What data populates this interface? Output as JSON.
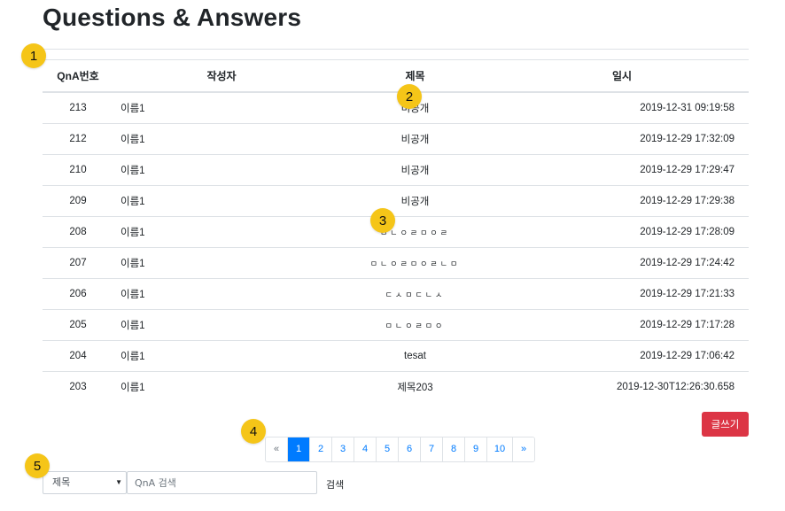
{
  "page_title": "Questions & Answers",
  "table": {
    "headers": {
      "no": "QnA번호",
      "writer": "작성자",
      "title": "제목",
      "date": "일시"
    },
    "rows": [
      {
        "no": "213",
        "writer": "이름1",
        "title": "비공개",
        "date": "2019-12-31 09:19:58",
        "kind": "private"
      },
      {
        "no": "212",
        "writer": "이름1",
        "title": "비공개",
        "date": "2019-12-29 17:32:09",
        "kind": "private"
      },
      {
        "no": "210",
        "writer": "이름1",
        "title": "비공개",
        "date": "2019-12-29 17:29:47",
        "kind": "private"
      },
      {
        "no": "209",
        "writer": "이름1",
        "title": "비공개",
        "date": "2019-12-29 17:29:38",
        "kind": "private"
      },
      {
        "no": "208",
        "writer": "이름1",
        "title": "ㅁㄴㅇㄹㅁㅇㄹ",
        "date": "2019-12-29 17:28:09",
        "kind": "jamo"
      },
      {
        "no": "207",
        "writer": "이름1",
        "title": "ㅁㄴㅇㄹㅁㅇㄹㄴㅁ",
        "date": "2019-12-29 17:24:42",
        "kind": "jamo"
      },
      {
        "no": "206",
        "writer": "이름1",
        "title": "ㄷㅅㅁㄷㄴㅅ",
        "date": "2019-12-29 17:21:33",
        "kind": "jamo"
      },
      {
        "no": "205",
        "writer": "이름1",
        "title": "ㅁㄴㅇㄹㅁㅇ",
        "date": "2019-12-29 17:17:28",
        "kind": "jamo"
      },
      {
        "no": "204",
        "writer": "이름1",
        "title": "tesat",
        "date": "2019-12-29 17:06:42",
        "kind": "link"
      },
      {
        "no": "203",
        "writer": "이름1",
        "title": "제목203",
        "date": "2019-12-30T12:26:30.658",
        "kind": "link"
      }
    ]
  },
  "write_button": "글쓰기",
  "pagination": {
    "prev": "«",
    "pages": [
      "1",
      "2",
      "3",
      "4",
      "5",
      "6",
      "7",
      "8",
      "9",
      "10"
    ],
    "next": "»",
    "active": "1"
  },
  "search": {
    "select_value": "제목",
    "input_placeholder": "QnA 검색",
    "button_label": "검색"
  },
  "annotations": [
    "1",
    "2",
    "3",
    "4",
    "5"
  ],
  "colors": {
    "accent": "#007bff",
    "danger": "#dc3545",
    "badge": "#f5c518"
  }
}
